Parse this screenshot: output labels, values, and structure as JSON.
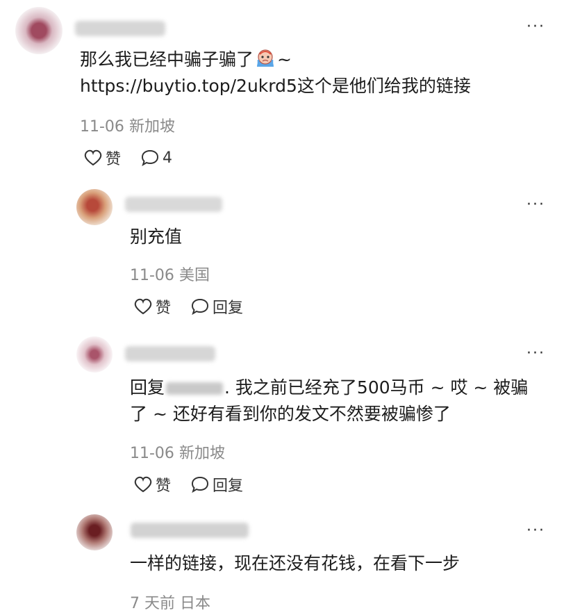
{
  "comments": [
    {
      "text_before": "那么我已经中骗子骗了",
      "text_after": "~",
      "text_line2": "https://buytio.top/2ukrd5这个是他们给我的链接",
      "date": "11-06",
      "location": "新加坡",
      "like_label": "赞",
      "reply_count": "4",
      "emoji": "crying-face-emoji",
      "more": "···"
    },
    {
      "text": "别充值",
      "date": "11-06",
      "location": "美国",
      "like_label": "赞",
      "reply_label": "回复",
      "more": "···"
    },
    {
      "reply_prefix": "回复",
      "text_line1": ". 我之前已经充了500马币 ~ 哎 ~ 被骗",
      "text_line2": "了 ~ 还好有看到你的发文不然要被骗惨了",
      "date": "11-06",
      "location": "新加坡",
      "like_label": "赞",
      "reply_label": "回复",
      "more": "···"
    },
    {
      "text": "一样的链接，现在还没有花钱，在看下一步",
      "date": "7 天前",
      "location": "日本",
      "more": "···"
    }
  ],
  "icons": {
    "like": "heart-outline-icon",
    "comment": "speech-bubble-icon",
    "more": "more-dots-icon"
  },
  "colors": {
    "text": "#1c1c1c",
    "meta": "#8a8a8a",
    "background": "#ffffff"
  }
}
